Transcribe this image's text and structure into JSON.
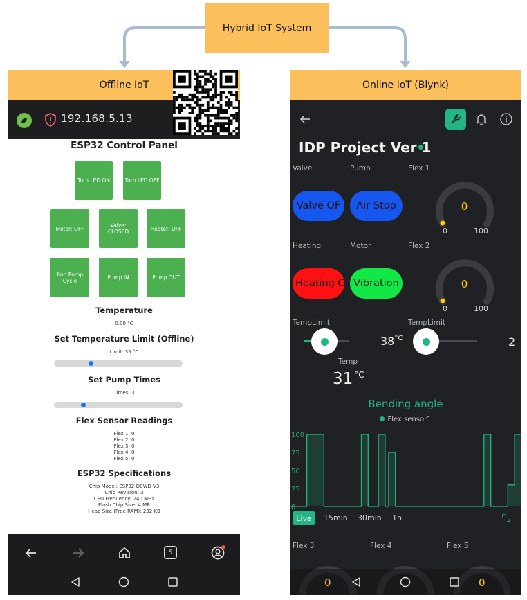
{
  "diagram": {
    "title": "Hybrid IoT System"
  },
  "offline": {
    "header": "Offline IoT",
    "url": "192.168.5.13",
    "panel_title": "ESP32 Control Panel",
    "buttons": {
      "led_on": "Turn LED ON",
      "led_off": "Turn LED OFF",
      "motor": "Motor: OFF",
      "valve": "Valve: CLOSED",
      "heater": "Heater: OFF",
      "run_pump": "Run Pump Cycle",
      "pump_in": "Pump IN",
      "pump_out": "Pump OUT"
    },
    "temperature": {
      "heading": "Temperature",
      "value": "0.00 °C"
    },
    "temp_limit": {
      "heading": "Set Temperature Limit (Offline)",
      "text": "Limit: 35 °C",
      "level": 0.29
    },
    "pump_times": {
      "heading": "Set Pump Times",
      "text": "Times: 3",
      "level": 0.23
    },
    "flex": {
      "heading": "Flex Sensor Readings",
      "lines": [
        "Flex 1: 0",
        "Flex 2: 0",
        "Flex 3: 0",
        "Flex 4: 0",
        "Flex 5: 0"
      ]
    },
    "specs": {
      "heading": "ESP32 Specifications",
      "lines": [
        "Chip Model: ESP32-D0WD-V3",
        "Chip Revision: 3",
        "CPU Frequency: 240 MHz",
        "Flash Chip Size: 4 MB",
        "Heap Size (Free RAM): 232 KB"
      ]
    },
    "nav": {
      "tab_count": "5"
    }
  },
  "online": {
    "header": "Online IoT (Blynk)",
    "project_title": "IDP Project Ver 1",
    "labels": {
      "valve": "Valve",
      "pump": "Pump",
      "flex1": "Flex 1",
      "heating": "Heating",
      "motor": "Motor",
      "flex2": "Flex 2",
      "templimit1": "TempLimit",
      "templimit2": "TempLimit",
      "temp": "Temp",
      "flex3": "Flex 3",
      "flex4": "Flex 4",
      "flex5": "Flex 5"
    },
    "buttons": {
      "valve": "Valve OF",
      "pump": "Air Stop",
      "heating": "Heating C",
      "motor": "Vibration"
    },
    "gauges": {
      "flex1": {
        "value": "0",
        "min": "0",
        "max": "100"
      },
      "flex2": {
        "value": "0",
        "min": "0",
        "max": "100"
      },
      "flex3": {
        "value": "0"
      },
      "flex5": {
        "value": "0"
      }
    },
    "slider1_value": "38",
    "slider1_unit": "°C",
    "slider2_value": "2",
    "temp_value": "31",
    "temp_unit": "°C",
    "chart_title": "Bending angle",
    "legend": "Flex sensor1",
    "ranges": [
      "Live",
      "15min",
      "30min",
      "1h"
    ],
    "colors": {
      "accent": "#23b586",
      "blue_button": "#1657f0",
      "red_button": "#ff1111",
      "green_button": "#11e845",
      "header": "#fbbf5b"
    }
  },
  "chart_data": {
    "type": "line",
    "title": "Bending angle",
    "series": [
      {
        "name": "Flex sensor1",
        "values": [
          0,
          0,
          0,
          0,
          0,
          100,
          100,
          100,
          100,
          100,
          0,
          0,
          0,
          0,
          0,
          0,
          0,
          0,
          0,
          0,
          0,
          100,
          100,
          0,
          0,
          0,
          100,
          100,
          0,
          75,
          75,
          0,
          0,
          0,
          0,
          0,
          0,
          0,
          0,
          0,
          0,
          0,
          0,
          0,
          0,
          0,
          0,
          0,
          0,
          0,
          0,
          0,
          0,
          0,
          0,
          0,
          0,
          100,
          100,
          0,
          0,
          0,
          0,
          0,
          30,
          30,
          100,
          100
        ]
      }
    ],
    "y_ticks": [
      "100",
      "75",
      "50",
      "25",
      "0"
    ],
    "ylim": [
      0,
      100
    ],
    "grid": false
  }
}
